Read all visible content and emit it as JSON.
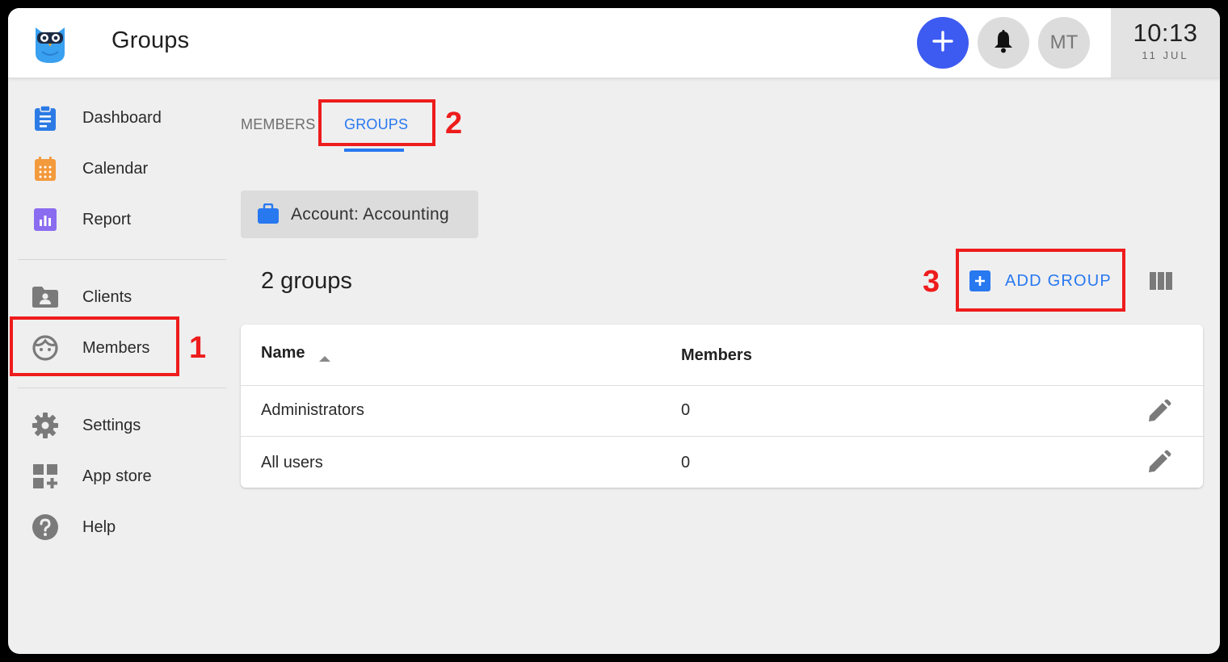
{
  "header": {
    "title": "Groups",
    "avatar_initials": "MT",
    "clock_time": "10:13",
    "clock_date": "11 JUL",
    "logo_icon": "owl-logo-icon",
    "add_icon": "plus-icon",
    "bell_icon": "bell-icon"
  },
  "sidebar": {
    "items": [
      {
        "label": "Dashboard",
        "icon": "clipboard-icon"
      },
      {
        "label": "Calendar",
        "icon": "calendar-icon"
      },
      {
        "label": "Report",
        "icon": "bar-chart-icon"
      },
      {
        "label": "Clients",
        "icon": "folder-user-icon"
      },
      {
        "label": "Members",
        "icon": "face-icon"
      },
      {
        "label": "Settings",
        "icon": "gear-icon"
      },
      {
        "label": "App store",
        "icon": "apps-add-icon"
      },
      {
        "label": "Help",
        "icon": "help-icon"
      }
    ]
  },
  "tabs": [
    {
      "label": "MEMBERS",
      "active": false
    },
    {
      "label": "GROUPS",
      "active": true
    }
  ],
  "account": {
    "label": "Account: Accounting",
    "icon": "briefcase-icon"
  },
  "groups": {
    "count_label": "2 groups",
    "add_label": "ADD GROUP",
    "columns_icon": "columns-icon"
  },
  "table": {
    "headers": [
      "Name",
      "Members"
    ],
    "sort": "ascending",
    "rows": [
      {
        "name": "Administrators",
        "members": "0"
      },
      {
        "name": "All users",
        "members": "0"
      }
    ]
  },
  "annotations": [
    "1",
    "2",
    "3"
  ],
  "colors": {
    "accent": "#2878f0",
    "fab": "#3d5af1",
    "annotation": "#ee1c1c"
  }
}
